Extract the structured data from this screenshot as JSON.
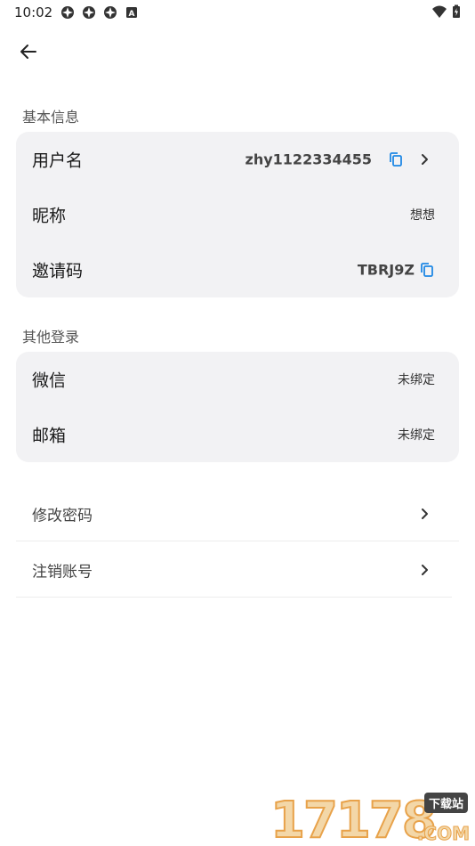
{
  "status_bar": {
    "time": "10:02",
    "left_icons": [
      "app-notification-icon",
      "app-notification-icon",
      "app-notification-icon",
      "keyboard-icon"
    ],
    "right_icons": [
      "wifi-icon",
      "battery-icon"
    ]
  },
  "sections": {
    "basic_info": {
      "title": "基本信息",
      "rows": {
        "username": {
          "label": "用户名",
          "value": "zhy1122334455"
        },
        "nickname": {
          "label": "昵称",
          "value": "想想"
        },
        "invite_code": {
          "label": "邀请码",
          "value": "TBRJ9Z"
        }
      }
    },
    "other_login": {
      "title": "其他登录",
      "rows": {
        "wechat": {
          "label": "微信",
          "value": "未绑定"
        },
        "email": {
          "label": "邮箱",
          "value": "未绑定"
        }
      }
    }
  },
  "actions": {
    "change_password": "修改密码",
    "delete_account": "注销账号"
  },
  "watermark": {
    "number": "17178",
    "badge": "下载站",
    "suffix": ".COM"
  },
  "colors": {
    "accent": "#1e88e5",
    "card_bg": "#f2f2f4",
    "watermark_fill": "#f3d7a8",
    "watermark_stroke": "#e8a24a"
  }
}
